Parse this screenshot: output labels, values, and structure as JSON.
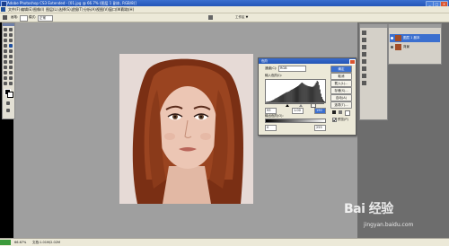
{
  "window": {
    "title": "Adobe Photoshop CS3 Extended - [01.jpg @ 66.7% (图层 1 副本, RGB/8)]",
    "controls": [
      "_",
      "□",
      "×"
    ]
  },
  "menu": [
    "文件(F)",
    "编辑(E)",
    "图像(I)",
    "图层(L)",
    "选择(S)",
    "滤镜(T)",
    "分析(A)",
    "视图(V)",
    "窗口(W)",
    "帮助(H)"
  ],
  "options": {
    "tool_label": "画笔:",
    "mode_label": "模式:",
    "mode_value": "正常",
    "workspace": "工作区 ▼"
  },
  "levels": {
    "title": "色阶",
    "channel_label": "通道(C):",
    "channel_value": "RGB",
    "input_label": "输入色阶(I):",
    "input_black": "93",
    "input_gamma": "1.00",
    "input_white": "190",
    "output_label": "输出色阶(O):",
    "output_black": "0",
    "output_white": "255",
    "buttons": [
      "确定",
      "取消",
      "载入(L)...",
      "存储(S)...",
      "自动(A)",
      "选项(T)..."
    ],
    "preview_label": "预览(P)",
    "preview_checked": true
  },
  "histogram": [
    2,
    3,
    3,
    4,
    5,
    6,
    8,
    10,
    12,
    15,
    18,
    20,
    22,
    25,
    27,
    30,
    32,
    35,
    37,
    40,
    42,
    45,
    47,
    48,
    50,
    52,
    55,
    58,
    60,
    62,
    65,
    67,
    70,
    72,
    75,
    78,
    82,
    86,
    90,
    92,
    88,
    85,
    82,
    80,
    78,
    76,
    75,
    74,
    73,
    72,
    72,
    74,
    78,
    85,
    92,
    100,
    95,
    80,
    60,
    40,
    25,
    15,
    8,
    4
  ],
  "layers": {
    "items": [
      {
        "name": "图层 1 副本",
        "selected": true
      },
      {
        "name": "背景",
        "selected": false
      }
    ]
  },
  "status": {
    "zoom": "66.67%",
    "doc": "文档:1.01M/2.02M"
  },
  "watermark": {
    "brand": "Bai 经验",
    "url": "jingyan.baidu.com"
  }
}
